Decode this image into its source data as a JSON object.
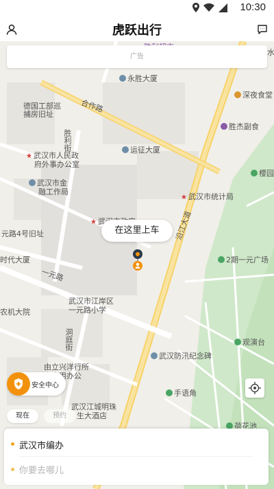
{
  "status_bar": {
    "time": "10:30"
  },
  "header": {
    "title": "虎跃出行",
    "profile_icon": "user-icon",
    "message_icon": "chat-icon"
  },
  "ad_banner": {
    "label": "广告"
  },
  "map": {
    "pickup_label": "在这里上车",
    "labels": {
      "yongsheng": "永胜大厦",
      "shenye": "深夜食堂",
      "deguo": "德国工部巡",
      "buwu": "捕房旧址",
      "shengjie": "胜杰副食",
      "yunzheng": "运征大厦",
      "renmin1": "武汉市人民政",
      "renmin2": "府外事办公室",
      "jinrong1": "武汉市金",
      "jinrong2": "融工作局",
      "tongji": "武汉市统计局",
      "zhengfu": "武汉市政府",
      "yiyuan": "元路4号旧址",
      "shidai": "时代大厦",
      "nongzhong": "农机大院",
      "jiangan1": "武汉市江岸区",
      "jiangan2": "一元路小学",
      "yiyuan_park": "2期一元广场",
      "guanyan": "观演台",
      "fangxun": "武汉防汛纪念碑",
      "youli1": "由立兴洋行所",
      "youli2": "市自用办公",
      "jiangchao1": "武汉江城明珠",
      "jiangchao2": "生大酒店",
      "shouxu": "手语角",
      "hehua": "荷花池",
      "yingyuan": "樱园",
      "road_yiyuan": "一元路",
      "road_yanjiang": "沿江大道",
      "road_shengli": "胜利街",
      "road_dongting": "洞庭街",
      "road_gouhe": "合作路",
      "top_cut": "胜利超市",
      "shui": "水"
    }
  },
  "safety": {
    "label": "安全中心"
  },
  "tabs": [
    {
      "label": "现在"
    },
    {
      "label": "预约"
    }
  ],
  "trip": {
    "origin": "武汉市编办",
    "destination_placeholder": "你要去哪儿"
  }
}
